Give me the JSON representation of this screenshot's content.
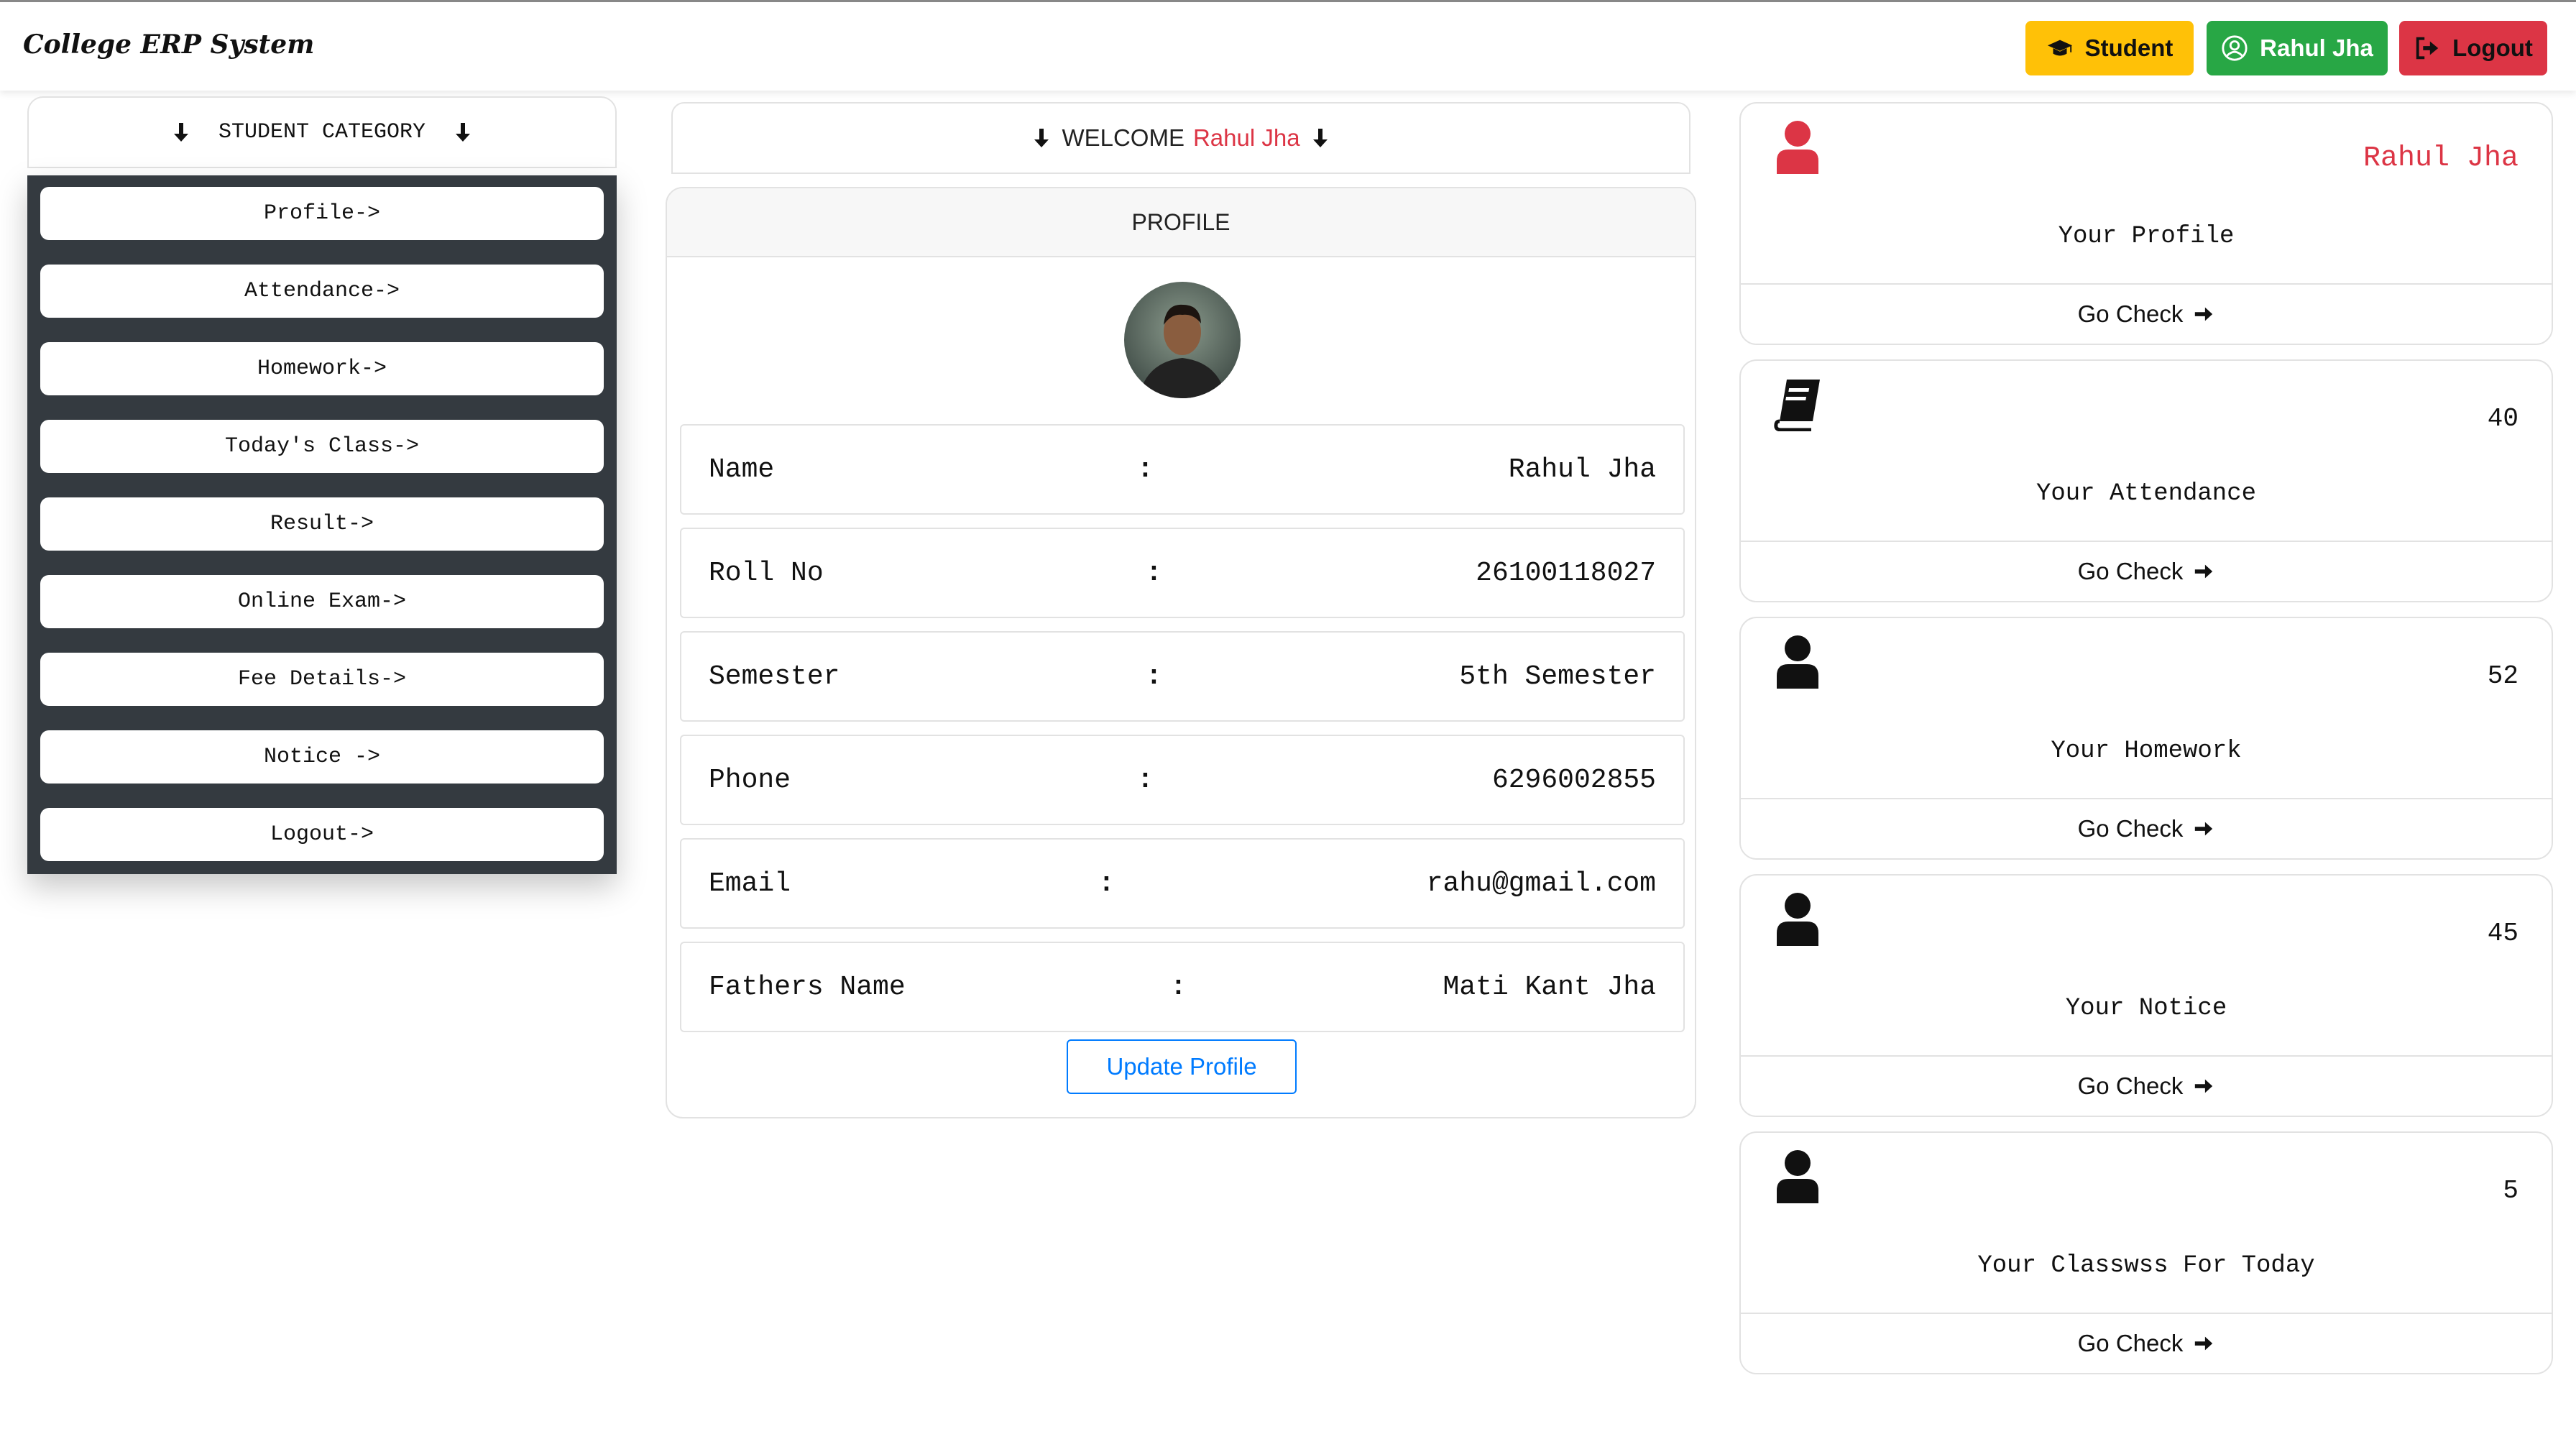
{
  "navbar": {
    "brand": "College ERP System",
    "student_label": "Student",
    "user_label": "Rahul Jha",
    "logout_label": "Logout"
  },
  "sidebar": {
    "heading": "STUDENT CATEGORY",
    "items": [
      {
        "label": "Profile->"
      },
      {
        "label": "Attendance->"
      },
      {
        "label": "Homework->"
      },
      {
        "label": "Today's Class->"
      },
      {
        "label": "Result->"
      },
      {
        "label": "Online Exam->"
      },
      {
        "label": "Fee Details->"
      },
      {
        "label": "Notice ->"
      },
      {
        "label": "Logout->"
      }
    ]
  },
  "welcome": {
    "prefix": "WELCOME",
    "name": "Rahul Jha"
  },
  "profile": {
    "header": "PROFILE",
    "rows": [
      {
        "label": "Name",
        "value": "Rahul Jha"
      },
      {
        "label": "Roll No",
        "value": "26100118027"
      },
      {
        "label": "Semester",
        "value": "5th Semester"
      },
      {
        "label": "Phone",
        "value": "6296002855"
      },
      {
        "label": "Email",
        "value": "rahu@gmail.com"
      },
      {
        "label": "Fathers Name",
        "value": "Mati Kant Jha"
      }
    ],
    "separator": ":",
    "update_label": "Update Profile"
  },
  "cards": [
    {
      "icon": "user-icon",
      "value": "Rahul Jha",
      "label": "Your Profile",
      "link": "Go Check"
    },
    {
      "icon": "book-icon",
      "value": "40",
      "label": "Your Attendance",
      "link": "Go Check"
    },
    {
      "icon": "user-icon",
      "value": "52",
      "label": "Your Homework",
      "link": "Go Check"
    },
    {
      "icon": "user-icon",
      "value": "45",
      "label": "Your Notice",
      "link": "Go Check"
    },
    {
      "icon": "user-icon",
      "value": "5",
      "label": "Your Classwss For Today",
      "link": "Go Check"
    }
  ],
  "colors": {
    "warning": "#ffc107",
    "success": "#28a745",
    "danger": "#dc3545",
    "primary": "#007bff",
    "sidebar_bg": "#343a40"
  }
}
